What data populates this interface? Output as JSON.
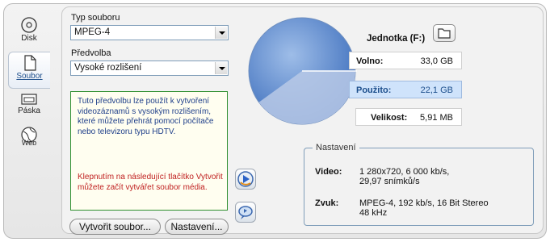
{
  "sidebar": {
    "items": [
      {
        "label": "Disk",
        "icon": "disc-icon"
      },
      {
        "label": "Soubor",
        "icon": "file-icon",
        "active": true
      },
      {
        "label": "Páska",
        "icon": "tape-icon"
      },
      {
        "label": "Web",
        "icon": "globe-icon"
      }
    ]
  },
  "file_type": {
    "label": "Typ souboru",
    "value": "MPEG-4"
  },
  "preset": {
    "label": "Předvolba",
    "value": "Vysoké rozlišení"
  },
  "description": {
    "text": "Tuto předvolbu lze použít k vytvoření videozáznamů s vysokým rozlišením, které můžete přehrát pomocí počítače nebo televizoru typu HDTV.",
    "hint": "Klepnutím na následující tlačítko Vytvořit můžete začít vytvářet soubor média."
  },
  "buttons": {
    "create": "Vytvořit soubor...",
    "settings": "Nastavení...",
    "play_icon": "play-icon",
    "burn_icon": "burn-icon"
  },
  "disk": {
    "drive": "Jednotka (F:)",
    "folder_icon": "folder-icon",
    "free_label": "Volno:",
    "free_value": "33,0 GB",
    "used_label": "Použito:",
    "used_value": "22,1 GB",
    "size_label": "Velikost:",
    "size_value": "5,91 MB",
    "used_fraction": 0.4,
    "colors": {
      "free": "#4a78c0",
      "used": "#b8c8e8",
      "highlight": "#cfe3fb"
    }
  },
  "settings_panel": {
    "title": "Nastavení",
    "video_label": "Video:",
    "video_line1": "1 280x720, 6 000 kb/s,",
    "video_line2": "29,97 snímků/s",
    "audio_label": "Zvuk:",
    "audio_line1": "MPEG-4, 192 kb/s, 16 Bit Stereo",
    "audio_line2": "48 kHz"
  }
}
